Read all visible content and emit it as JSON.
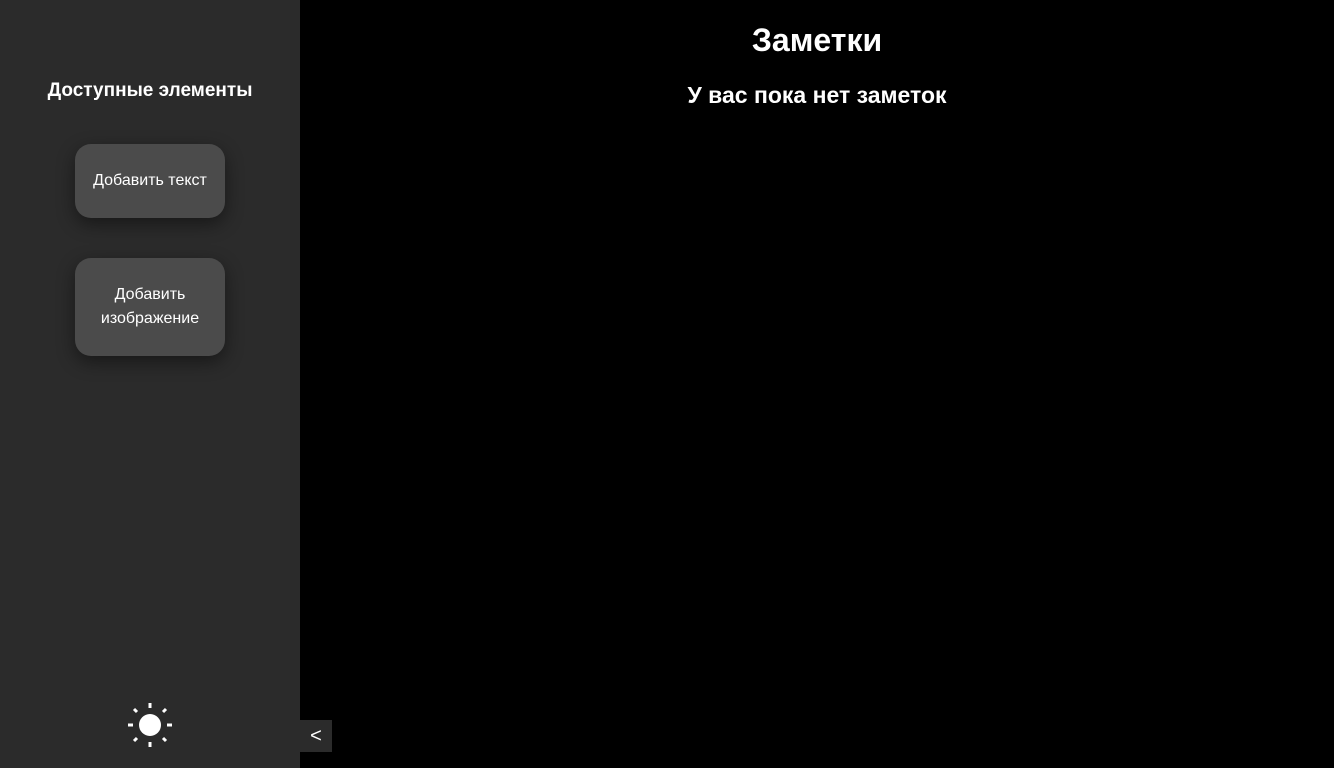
{
  "sidebar": {
    "title": "Доступные элементы",
    "buttons": {
      "add_text": "Добавить текст",
      "add_image": "Добавить изображение"
    },
    "theme_toggle_icon": "sun-icon",
    "collapse_label": "<"
  },
  "main": {
    "title": "Заметки",
    "empty_message": "У вас пока нет заметок"
  },
  "colors": {
    "page_background": "#000000",
    "sidebar_background": "#2b2b2b",
    "button_background": "#4b4b4b",
    "text": "#ffffff"
  }
}
